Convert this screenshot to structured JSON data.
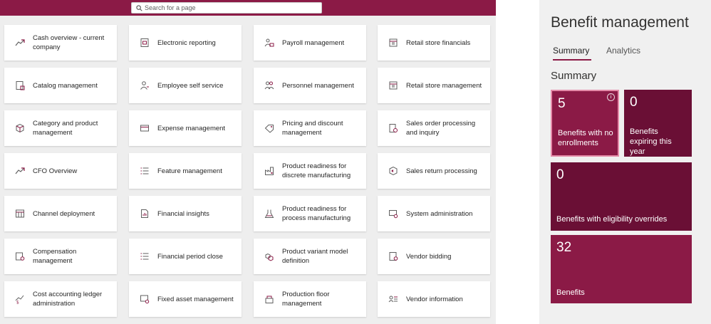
{
  "search": {
    "placeholder": "Search for a page",
    "icon": "search-icon"
  },
  "tiles": [
    {
      "label": "Cash overview - current company",
      "icon": "trend-icon"
    },
    {
      "label": "Electronic reporting",
      "icon": "report-icon"
    },
    {
      "label": "Payroll management",
      "icon": "people-money-icon"
    },
    {
      "label": "Retail store financials",
      "icon": "store-icon"
    },
    {
      "label": "Catalog management",
      "icon": "catalog-icon"
    },
    {
      "label": "Employee self service",
      "icon": "person-icon"
    },
    {
      "label": "Personnel management",
      "icon": "people-icon"
    },
    {
      "label": "Retail store management",
      "icon": "store-icon"
    },
    {
      "label": "Category and product management",
      "icon": "box-icon"
    },
    {
      "label": "Expense management",
      "icon": "card-icon"
    },
    {
      "label": "Pricing and discount management",
      "icon": "tag-icon"
    },
    {
      "label": "Sales order processing and inquiry",
      "icon": "order-icon"
    },
    {
      "label": "CFO Overview",
      "icon": "trend-icon"
    },
    {
      "label": "Feature management",
      "icon": "list-icon"
    },
    {
      "label": "Product readiness for discrete manufacturing",
      "icon": "factory-icon"
    },
    {
      "label": "Sales return processing",
      "icon": "box-return-icon"
    },
    {
      "label": "Channel deployment",
      "icon": "deploy-icon"
    },
    {
      "label": "Financial insights",
      "icon": "chart-doc-icon"
    },
    {
      "label": "Product readiness for process manufacturing",
      "icon": "flask-icon"
    },
    {
      "label": "System administration",
      "icon": "admin-icon"
    },
    {
      "label": "Compensation management",
      "icon": "money-icon"
    },
    {
      "label": "Financial period close",
      "icon": "list-icon"
    },
    {
      "label": "Product variant model definition",
      "icon": "variant-icon"
    },
    {
      "label": "Vendor bidding",
      "icon": "bid-icon"
    },
    {
      "label": "Cost accounting ledger administration",
      "icon": "ledger-icon"
    },
    {
      "label": "Fixed asset management",
      "icon": "asset-icon"
    },
    {
      "label": "Production floor management",
      "icon": "production-icon"
    },
    {
      "label": "Vendor information",
      "icon": "vendor-icon"
    }
  ],
  "workspace": {
    "title": "Benefit management",
    "tabs": [
      {
        "label": "Summary",
        "active": true
      },
      {
        "label": "Analytics",
        "active": false
      }
    ],
    "section_title": "Summary",
    "kpis": [
      {
        "value": "5",
        "caption": "Benefits with no enrollments",
        "color": "#8b1a46"
      },
      {
        "value": "0",
        "caption": "Benefits expiring this year",
        "color": "#6a0f35"
      },
      {
        "value": "0",
        "caption": "Benefits with eligibility overrides",
        "color": "#6a0f35"
      },
      {
        "value": "32",
        "caption": "Benefits",
        "color": "#8b1a46"
      }
    ]
  },
  "colors": {
    "brand": "#8b1a46",
    "brand_dark": "#6a0f35"
  }
}
